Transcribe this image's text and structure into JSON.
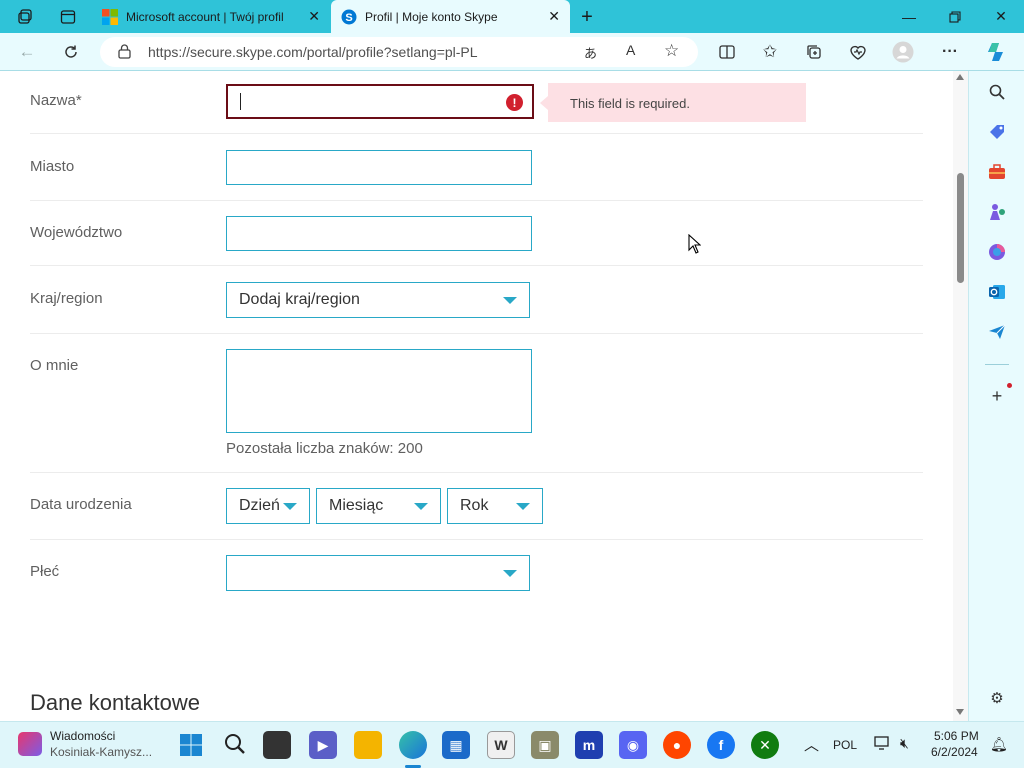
{
  "browser": {
    "tabs": [
      {
        "title": "Microsoft account | Twój profil"
      },
      {
        "title": "Profil | Moje konto Skype"
      }
    ],
    "url": "https://secure.skype.com/portal/profile?setlang=pl-PL"
  },
  "form": {
    "name": {
      "label": "Nazwa*",
      "value": "",
      "error": "This field is required."
    },
    "city": {
      "label": "Miasto",
      "value": ""
    },
    "province": {
      "label": "Województwo",
      "value": ""
    },
    "country": {
      "label": "Kraj/region",
      "selected": "Dodaj kraj/region"
    },
    "about": {
      "label": "O mnie",
      "value": "",
      "remaining": "Pozostała liczba znaków: 200"
    },
    "birthdate": {
      "label": "Data urodzenia",
      "day": "Dzień",
      "month": "Miesiąc",
      "year": "Rok"
    },
    "gender": {
      "label": "Płeć",
      "selected": ""
    },
    "contact_heading": "Dane kontaktowe"
  },
  "taskbar": {
    "notification": {
      "title": "Wiadomości",
      "subtitle": "Kosiniak-Kamysz..."
    },
    "language": "POL",
    "time": "5:06 PM",
    "date": "6/2/2024"
  },
  "colors": {
    "accent": "#29a8c7",
    "error_border": "#6b0d16",
    "error_bg": "#fde0e4",
    "titlebar": "#2fc3d8"
  }
}
